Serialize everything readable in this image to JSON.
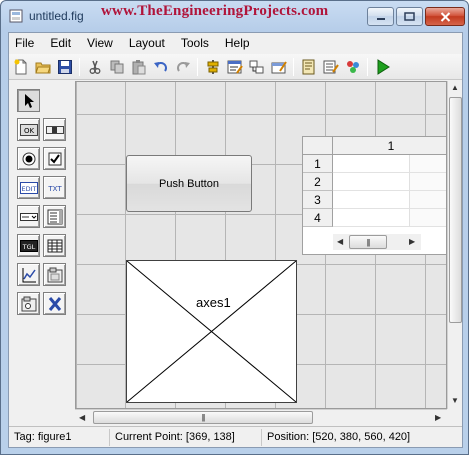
{
  "window": {
    "title": "untitled.fig",
    "watermark": "www.TheEngineeringProjects.com"
  },
  "menu": [
    "File",
    "Edit",
    "View",
    "Layout",
    "Tools",
    "Help"
  ],
  "toolbar": {
    "buttons": [
      "new-file",
      "open-folder",
      "save",
      "cut",
      "copy",
      "paste",
      "undo",
      "redo",
      "align-objects",
      "menu-editor",
      "tab-order-editor",
      "toolbar-editor",
      "editor",
      "property-inspector",
      "object-browser",
      "run-figure"
    ]
  },
  "palette": {
    "items": [
      "select-tool",
      "push-button-tool",
      "slider-tool",
      "radio-button-tool",
      "check-box-tool",
      "edit-text-tool",
      "static-text-tool",
      "popup-menu-tool",
      "listbox-tool",
      "toggle-button-tool",
      "table-tool",
      "axes-tool",
      "panel-tool",
      "button-group-tool",
      "activex-control-tool"
    ],
    "glyphs": {
      "push": "OK",
      "edit": "EDIT",
      "text": "TXT",
      "toggle": "TGL"
    }
  },
  "canvas": {
    "push_button_label": "Push Button",
    "table": {
      "column_headers": [
        "1"
      ],
      "row_headers": [
        "1",
        "2",
        "3",
        "4"
      ]
    },
    "axes_label": "axes1"
  },
  "status": {
    "tag": "Tag: figure1",
    "current_point": "Current Point:  [369, 138]",
    "position": "Position: [520, 380, 560, 420]"
  },
  "colors": {
    "title_bar": "#c9dcf2",
    "watermark": "#b0143a",
    "close_button": "#c23a1f",
    "run_button": "#1ea01e"
  }
}
